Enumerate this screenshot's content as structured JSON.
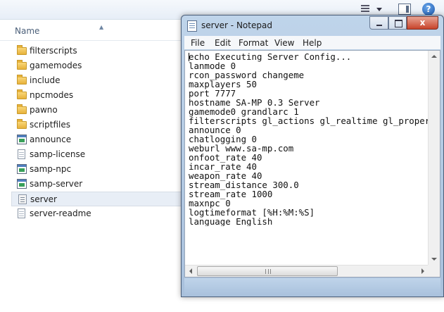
{
  "explorer": {
    "column_header": {
      "name_label": "Name"
    },
    "files": [
      {
        "name": "filterscripts",
        "icon": "folder-icon",
        "selected": false
      },
      {
        "name": "gamemodes",
        "icon": "folder-icon",
        "selected": false
      },
      {
        "name": "include",
        "icon": "folder-icon",
        "selected": false
      },
      {
        "name": "npcmodes",
        "icon": "folder-icon",
        "selected": false
      },
      {
        "name": "pawno",
        "icon": "folder-icon",
        "selected": false
      },
      {
        "name": "scriptfiles",
        "icon": "folder-icon",
        "selected": false
      },
      {
        "name": "announce",
        "icon": "application-icon",
        "selected": false
      },
      {
        "name": "samp-license",
        "icon": "text-document-icon",
        "selected": false
      },
      {
        "name": "samp-npc",
        "icon": "application-icon",
        "selected": false
      },
      {
        "name": "samp-server",
        "icon": "application-icon",
        "selected": false
      },
      {
        "name": "server",
        "icon": "config-document-icon",
        "selected": true
      },
      {
        "name": "server-readme",
        "icon": "text-document-icon",
        "selected": false
      }
    ]
  },
  "notepad": {
    "title": "server - Notepad",
    "close_glyph": "x",
    "menu": {
      "file": "File",
      "edit": "Edit",
      "format": "Format",
      "view": "View",
      "help": "Help"
    },
    "lines": [
      "echo Executing Server Config...",
      "lanmode 0",
      "rcon_password changeme",
      "maxplayers 50",
      "port 7777",
      "hostname SA-MP 0.3 Server",
      "gamemode0 grandlarc 1",
      "filterscripts gl_actions gl_realtime gl_property",
      "announce 0",
      "chatlogging 0",
      "weburl www.sa-mp.com",
      "onfoot_rate 40",
      "incar_rate 40",
      "weapon_rate 40",
      "stream_distance 300.0",
      "stream_rate 1000",
      "maxnpc 0",
      "logtimeformat [%H:%M:%S]",
      "language English"
    ]
  },
  "toolbar": {
    "help_glyph": "?"
  },
  "colors": {
    "selection": "#e8eef6",
    "window_frame": "#bfd4ea",
    "close_button": "#c7432a",
    "folder": "#e7b23a"
  }
}
